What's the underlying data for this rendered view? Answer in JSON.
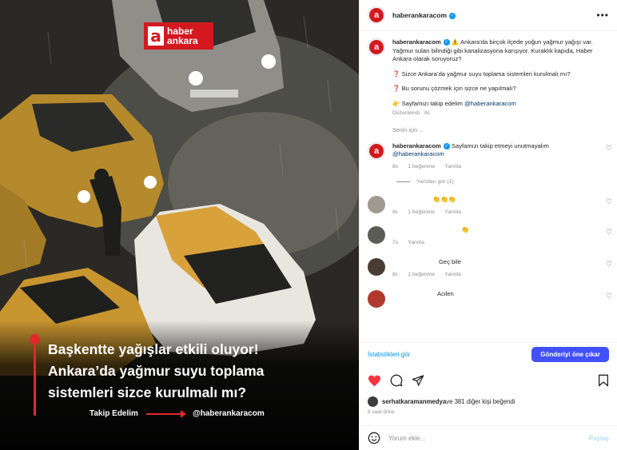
{
  "post_image": {
    "logo": {
      "glyph": "a",
      "line1": "haber",
      "line2": "ankara"
    },
    "headline_lines": [
      "Başkentte yağışlar etkili oluyor!",
      "Ankara’da yağmur suyu toplama",
      "sistemleri sizce kurulmalı mı?"
    ],
    "follow_label": "Takip Edelim",
    "follow_handle": "@haberankaracom"
  },
  "header": {
    "username": "haberankaracom",
    "more_icon": "ellipsis-icon"
  },
  "caption": {
    "username": "haberankaracom",
    "intro": "⚠️ Ankara’da birçok ilçede yoğun yağmur yağışı var. Yağmur suları bilindiği gibi kanalizasyona karışıyor. Kuraklık kapıda, Haber Ankara olarak soruyoruz?",
    "question1": "❓ Sizce Ankara’da yağmur suyu toplama sistemleri kurulmalı mı?",
    "question2": "❓ Bu sorunu çözmek için sizce ne yapılmalı?",
    "follow_text": "👉 Sayfamızı takip edelim ",
    "follow_mention": "@haberankaracom",
    "edited": "Düzenlendi · 8c",
    "for_you": "Senin için ⌵"
  },
  "comments": [
    {
      "username": "haberankaracom",
      "text": "Sayfamızı takip etmeyi unutmayalım ",
      "mention": "@haberankaracom",
      "time": "8c",
      "likes": "1 beğenme",
      "reply": "Yanıtla",
      "view_replies": "Yanıtları gör (1)"
    },
    {
      "username": "",
      "text": "👏👏👏",
      "time": "8c",
      "likes": "1 beğenme",
      "reply": "Yanıtla"
    },
    {
      "username": "",
      "text": "👏",
      "time": "7s",
      "likes": "",
      "reply": "Yanıtla"
    },
    {
      "username": "",
      "text": "Geç bile",
      "time": "8c",
      "likes": "1 beğenme",
      "reply": "Yanıtla"
    },
    {
      "username": "",
      "text": "Acilen",
      "time": "",
      "likes": "",
      "reply": ""
    }
  ],
  "bottom": {
    "stats_link": "İstatistikleri gör",
    "boost_button": "Gönderiyi öne çıkar",
    "likes_user": "serhatkaramanmedya",
    "likes_rest": " ve 381 diğer kişi beğendi",
    "timestamp": "8 saat önce"
  },
  "compose": {
    "placeholder": "Yorum ekle...",
    "share": "Paylaş"
  },
  "colors": {
    "brand_red": "#d3191f",
    "blue": "#0095f6",
    "boost": "#4150f7",
    "like_red": "#ff3040"
  }
}
